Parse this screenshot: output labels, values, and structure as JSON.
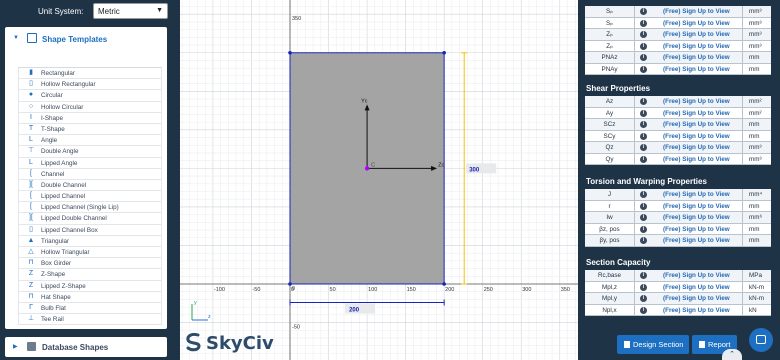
{
  "left": {
    "unit_system_label": "Unit System:",
    "unit_system_value": "Metric",
    "shape_templates_title": "Shape Templates",
    "shapes": [
      {
        "label": "Rectangular",
        "icon": "rectangle-icon",
        "glyph": "▮"
      },
      {
        "label": "Hollow Rectangular",
        "icon": "hollow-rectangle-icon",
        "glyph": "▯"
      },
      {
        "label": "Circular",
        "icon": "circle-icon",
        "glyph": "●"
      },
      {
        "label": "Hollow Circular",
        "icon": "hollow-circle-icon",
        "glyph": "○"
      },
      {
        "label": "I-Shape",
        "icon": "i-shape-icon",
        "glyph": "I"
      },
      {
        "label": "T-Shape",
        "icon": "t-shape-icon",
        "glyph": "T"
      },
      {
        "label": "Angle",
        "icon": "angle-icon",
        "glyph": "L"
      },
      {
        "label": "Double Angle",
        "icon": "double-angle-icon",
        "glyph": "⊤"
      },
      {
        "label": "Lipped Angle",
        "icon": "lipped-angle-icon",
        "glyph": "L"
      },
      {
        "label": "Channel",
        "icon": "channel-icon",
        "glyph": "["
      },
      {
        "label": "Double Channel",
        "icon": "double-channel-icon",
        "glyph": "]["
      },
      {
        "label": "Lipped Channel",
        "icon": "lipped-channel-icon",
        "glyph": "["
      },
      {
        "label": "Lipped Channel (Single Lip)",
        "icon": "lipped-channel-single-icon",
        "glyph": "["
      },
      {
        "label": "Lipped Double Channel",
        "icon": "lipped-double-channel-icon",
        "glyph": "]["
      },
      {
        "label": "Lipped Channel Box",
        "icon": "lipped-channel-box-icon",
        "glyph": "▯"
      },
      {
        "label": "Triangular",
        "icon": "triangle-icon",
        "glyph": "▲"
      },
      {
        "label": "Hollow Triangular",
        "icon": "hollow-triangle-icon",
        "glyph": "△"
      },
      {
        "label": "Box Girder",
        "icon": "box-girder-icon",
        "glyph": "⊓"
      },
      {
        "label": "Z-Shape",
        "icon": "z-shape-icon",
        "glyph": "Z"
      },
      {
        "label": "Lipped Z-Shape",
        "icon": "lipped-z-shape-icon",
        "glyph": "Z"
      },
      {
        "label": "Hat Shape",
        "icon": "hat-shape-icon",
        "glyph": "⊓"
      },
      {
        "label": "Bulb Flat",
        "icon": "bulb-flat-icon",
        "glyph": "Γ"
      },
      {
        "label": "Tee Rail",
        "icon": "tee-rail-icon",
        "glyph": "⊥"
      }
    ],
    "database_shapes_title": "Database Shapes"
  },
  "canvas": {
    "x_ticks": [
      "-100",
      "-50",
      "0",
      "50",
      "100",
      "150",
      "200",
      "250",
      "300",
      "350"
    ],
    "y_ticks": [
      "350",
      "300",
      "250",
      "200",
      "150",
      "100",
      "50",
      "0",
      "-50"
    ],
    "height_dim": "300",
    "width_dim": "200",
    "centroid_label": "C",
    "axis_y_label": "Yc",
    "axis_z_label": "Zc",
    "mini_axis_y": "y",
    "mini_axis_z": "z",
    "logo_text": "SkyCiv",
    "shape_color": "#a4a4a4",
    "outline_color": "#1a23b8",
    "centroid_color": "#b400ff"
  },
  "right": {
    "plastic_rows": [
      {
        "name": "Sₚ",
        "value": "(Free) Sign Up to View",
        "unit": "mm³"
      },
      {
        "name": "Sₚ",
        "value": "(Free) Sign Up to View",
        "unit": "mm³"
      },
      {
        "name": "Zₚ",
        "value": "(Free) Sign Up to View",
        "unit": "mm³"
      },
      {
        "name": "Zₚ",
        "value": "(Free) Sign Up to View",
        "unit": "mm³"
      },
      {
        "name": "PNAz",
        "value": "(Free) Sign Up to View",
        "unit": "mm"
      },
      {
        "name": "PNAy",
        "value": "(Free) Sign Up to View",
        "unit": "mm"
      }
    ],
    "shear_title": "Shear Properties",
    "shear_rows": [
      {
        "name": "Az",
        "value": "(Free) Sign Up to View",
        "unit": "mm²"
      },
      {
        "name": "Ay",
        "value": "(Free) Sign Up to View",
        "unit": "mm²"
      },
      {
        "name": "SCz",
        "value": "(Free) Sign Up to View",
        "unit": "mm"
      },
      {
        "name": "SCy",
        "value": "(Free) Sign Up to View",
        "unit": "mm"
      },
      {
        "name": "Qz",
        "value": "(Free) Sign Up to View",
        "unit": "mm³"
      },
      {
        "name": "Qy",
        "value": "(Free) Sign Up to View",
        "unit": "mm³"
      }
    ],
    "torsion_title": "Torsion and Warping Properties",
    "torsion_rows": [
      {
        "name": "J",
        "value": "(Free) Sign Up to View",
        "unit": "mm⁴"
      },
      {
        "name": "r",
        "value": "(Free) Sign Up to View",
        "unit": "mm"
      },
      {
        "name": "Iw",
        "value": "(Free) Sign Up to View",
        "unit": "mm⁶"
      },
      {
        "name": "βz, pos",
        "value": "(Free) Sign Up to View",
        "unit": "mm"
      },
      {
        "name": "βy, pos",
        "value": "(Free) Sign Up to View",
        "unit": "mm"
      }
    ],
    "capacity_title": "Section Capacity",
    "capacity_rows": [
      {
        "name": "Rc,base",
        "value": "(Free) Sign Up to View",
        "unit": "MPa"
      },
      {
        "name": "Mpl,z",
        "value": "(Free) Sign Up to View",
        "unit": "kN-m"
      },
      {
        "name": "Mpl,y",
        "value": "(Free) Sign Up to View",
        "unit": "kN-m"
      },
      {
        "name": "Npl,x",
        "value": "(Free) Sign Up to View",
        "unit": "kN"
      }
    ],
    "design_section_label": "Design Section",
    "report_label": "Report",
    "scroll_up_glyph": "⌃"
  }
}
